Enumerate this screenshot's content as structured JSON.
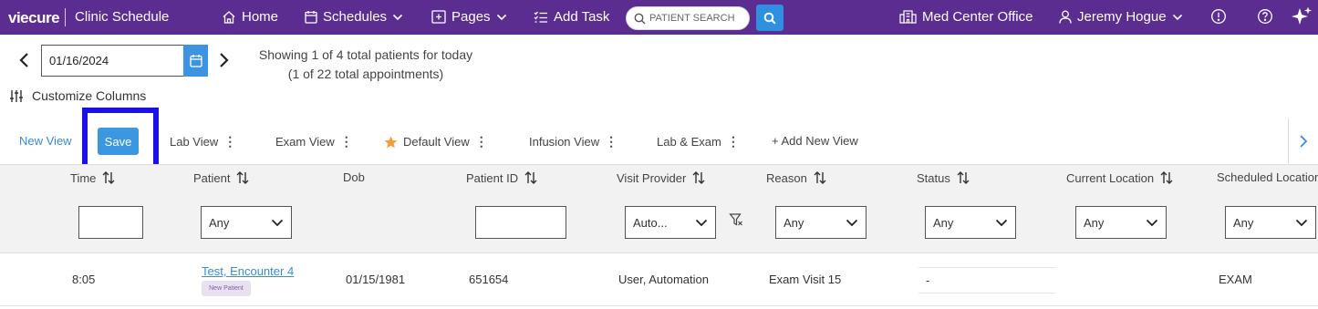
{
  "nav": {
    "brand": "viecure",
    "app_title": "Clinic Schedule",
    "items": [
      {
        "label": "Home",
        "icon": "home-icon"
      },
      {
        "label": "Schedules",
        "icon": "calendar-icon"
      },
      {
        "label": "Pages",
        "icon": "pages-icon"
      },
      {
        "label": "Add Task",
        "icon": "task-list-icon"
      }
    ],
    "search_placeholder": "PATIENT SEARCH",
    "office": "Med Center Office",
    "user": "Jeremy Hogue"
  },
  "date_nav": {
    "date_value": "01/16/2024",
    "showing_line1": "Showing 1 of 4 total patients for today",
    "showing_line2": "(1 of 22 total appointments)"
  },
  "customize_label": "Customize Columns",
  "views": {
    "new_view": "New View",
    "save": "Save",
    "items": [
      {
        "label": "Lab View",
        "starred": false
      },
      {
        "label": "Exam View",
        "starred": false
      },
      {
        "label": "Default View",
        "starred": true
      },
      {
        "label": "Infusion View",
        "starred": false
      },
      {
        "label": "Lab & Exam",
        "starred": false
      }
    ],
    "add_new": "+ Add New View"
  },
  "table": {
    "columns": [
      "Time",
      "Patient",
      "Dob",
      "Patient ID",
      "Visit Provider",
      "Reason",
      "Status",
      "Current Location",
      "Scheduled Location"
    ],
    "filters": {
      "patient": "Any",
      "provider": "Auto...",
      "reason": "Any",
      "status": "Any",
      "current_location": "Any",
      "scheduled_location": "Any"
    },
    "rows": [
      {
        "time": "8:05",
        "patient": "Test, Encounter 4",
        "badge": "New Patient",
        "dob": "01/15/1981",
        "patient_id": "651654",
        "provider": "User, Automation",
        "reason": "Exam Visit 15",
        "status": "-",
        "current_location": "",
        "scheduled_location": "EXAM"
      }
    ]
  },
  "colors": {
    "topbar": "#5b2d90",
    "accent_blue": "#3b97e2",
    "highlight_box": "#1a10e8",
    "star": "#f0a030"
  }
}
